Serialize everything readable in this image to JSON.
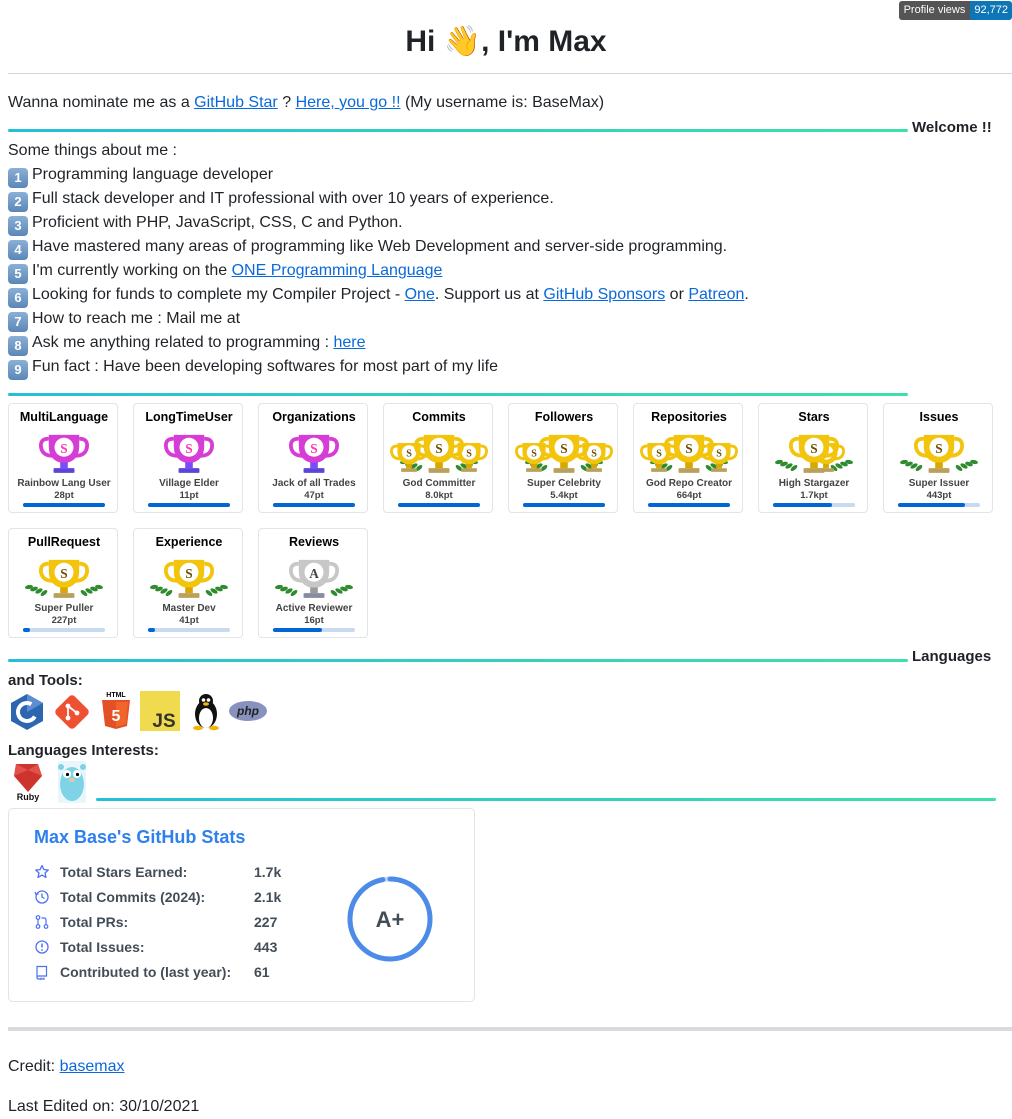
{
  "badge": {
    "key": "Profile views",
    "value": "92,772"
  },
  "title": "Hi 👋, I'm Max",
  "nominate": {
    "prefix": "Wanna nominate me as a ",
    "star_link": "GitHub Star",
    "middle": " ? ",
    "go_link": "Here, you go !!",
    "suffix": " (My username is: BaseMax)"
  },
  "welcome_label": "Welcome !!",
  "about": {
    "intro": "Some things about me :",
    "items": [
      {
        "key": "1",
        "text": "Programming language developer"
      },
      {
        "key": "2",
        "text": "Full stack developer and IT professional with over 10 years of experience."
      },
      {
        "key": "3",
        "text": "Proficient with PHP, JavaScript, CSS, C and Python."
      },
      {
        "key": "4",
        "text": "Have mastered many areas of programming like Web Development and server-side programming."
      },
      {
        "key": "5",
        "text": "I'm currently working on the ",
        "link": "ONE Programming Language"
      },
      {
        "key": "6",
        "text": "Looking for funds to complete my Compiler Project - ",
        "link1": "One",
        "mid": ". Support us at ",
        "link2": "GitHub Sponsors",
        "mid2": " or ",
        "link3": "Patreon",
        "end": "."
      },
      {
        "key": "7",
        "text": "How to reach me : Mail me at"
      },
      {
        "key": "8",
        "text": "Ask me anything related to programming : ",
        "link": "here"
      },
      {
        "key": "9",
        "text": "Fun fact : Have been developing softwares for most part of my life"
      }
    ]
  },
  "trophies": [
    {
      "title": "MultiLanguage",
      "rank": "S",
      "name": "Rainbow Lang User",
      "points": "28pt",
      "progress": 1.0,
      "style": "rainbow"
    },
    {
      "title": "LongTimeUser",
      "rank": "S",
      "name": "Village Elder",
      "points": "11pt",
      "progress": 1.0,
      "style": "rainbow"
    },
    {
      "title": "Organizations",
      "rank": "S",
      "name": "Jack of all Trades",
      "points": "47pt",
      "progress": 1.0,
      "style": "rainbow"
    },
    {
      "title": "Commits",
      "rank": "SSS",
      "name": "God Committer",
      "points": "8.0kpt",
      "progress": 1.0,
      "style": "gold"
    },
    {
      "title": "Followers",
      "rank": "SSS",
      "name": "Super Celebrity",
      "points": "5.4kpt",
      "progress": 1.0,
      "style": "gold"
    },
    {
      "title": "Repositories",
      "rank": "SSS",
      "name": "God Repo Creator",
      "points": "664pt",
      "progress": 1.0,
      "style": "gold"
    },
    {
      "title": "Stars",
      "rank": "SS",
      "name": "High Stargazer",
      "points": "1.7kpt",
      "progress": 0.72,
      "style": "gold"
    },
    {
      "title": "Issues",
      "rank": "S",
      "name": "Super Issuer",
      "points": "443pt",
      "progress": 0.82,
      "style": "gold"
    },
    {
      "title": "PullRequest",
      "rank": "S",
      "name": "Super Puller",
      "points": "227pt",
      "progress": 0.08,
      "style": "gold"
    },
    {
      "title": "Experience",
      "rank": "S",
      "name": "Master Dev",
      "points": "41pt",
      "progress": 0.08,
      "style": "gold"
    },
    {
      "title": "Reviews",
      "rank": "A",
      "name": "Active Reviewer",
      "points": "16pt",
      "progress": 0.6,
      "style": "silver"
    }
  ],
  "languages_label": "Languages",
  "tools_label": "and Tools:",
  "tools": [
    {
      "name": "C",
      "icon": "c-logo-icon"
    },
    {
      "name": "Git",
      "icon": "git-logo-icon"
    },
    {
      "name": "HTML5",
      "icon": "html5-logo-icon"
    },
    {
      "name": "JS",
      "icon": "javascript-logo-icon"
    },
    {
      "name": "Linux",
      "icon": "linux-tux-icon"
    },
    {
      "name": "php",
      "icon": "php-logo-icon"
    }
  ],
  "interests_label": "Languages Interests:",
  "interests": [
    {
      "name": "Ruby",
      "icon": "ruby-logo-icon"
    },
    {
      "name": "Go",
      "icon": "go-gopher-icon"
    }
  ],
  "stats": {
    "title": "Max Base's GitHub Stats",
    "rows": [
      {
        "label": "Total Stars Earned:",
        "value": "1.7k",
        "icon": "star-icon"
      },
      {
        "label": "Total Commits (2024):",
        "value": "2.1k",
        "icon": "history-icon"
      },
      {
        "label": "Total PRs:",
        "value": "227",
        "icon": "pull-request-icon"
      },
      {
        "label": "Total Issues:",
        "value": "443",
        "icon": "issue-icon"
      },
      {
        "label": "Contributed to (last year):",
        "value": "61",
        "icon": "repo-icon"
      }
    ],
    "rank": "A+",
    "rank_progress": 0.97,
    "accent": "#2f80ed"
  },
  "credit": {
    "prefix": "Credit: ",
    "link": "basemax"
  },
  "last_edited": "Last Edited on: 30/10/2021"
}
